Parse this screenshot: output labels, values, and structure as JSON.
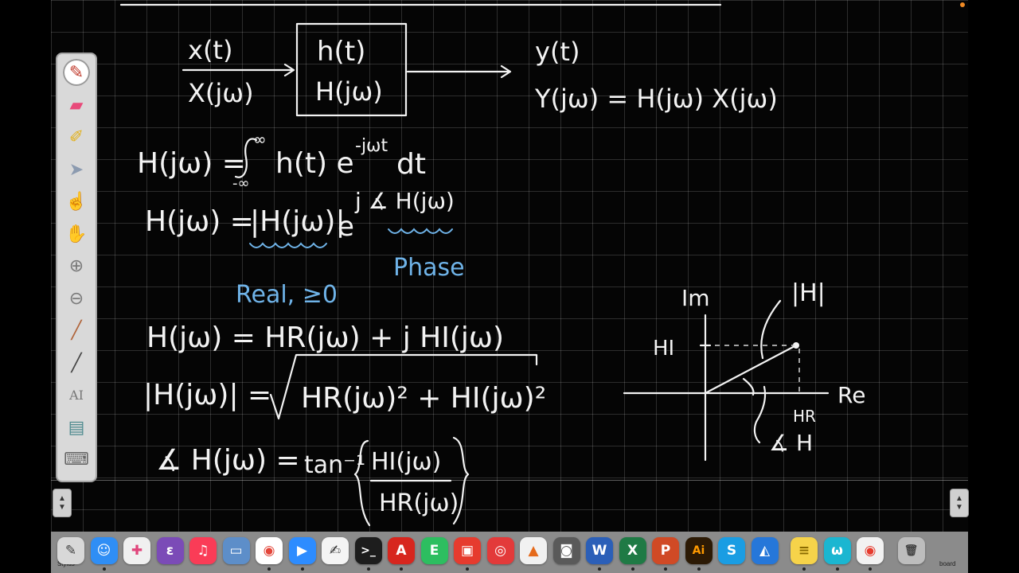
{
  "toolbar": {
    "tools": [
      {
        "name": "pen-icon",
        "glyph": "✎",
        "active": true
      },
      {
        "name": "eraser-icon",
        "glyph": "▰"
      },
      {
        "name": "highlighter-icon",
        "glyph": "✐"
      },
      {
        "name": "pointer-icon",
        "glyph": "➤"
      },
      {
        "name": "laser-pointer-icon",
        "glyph": "☝"
      },
      {
        "name": "hand-pan-icon",
        "glyph": "✋"
      },
      {
        "name": "zoom-in-icon",
        "glyph": "⊕"
      },
      {
        "name": "zoom-out-icon",
        "glyph": "⊖"
      },
      {
        "name": "brush-icon",
        "glyph": "╱"
      },
      {
        "name": "line-icon",
        "glyph": "╱"
      },
      {
        "name": "text-icon",
        "glyph": "AI"
      },
      {
        "name": "background-icon",
        "glyph": "▤"
      },
      {
        "name": "keyboard-icon",
        "glyph": "⌨"
      }
    ]
  },
  "equations": {
    "block_input_time": "x(t)",
    "block_input_freq": "X(jω)",
    "block_h_time": "h(t)",
    "block_h_freq": "H(jω)",
    "block_output_time": "y(t)",
    "block_output_freq": "Y(jω) = H(jω) X(jω)",
    "fourier_lhs": "H(jω) =",
    "fourier_upper_limit": "∞",
    "fourier_lower_limit": "-∞",
    "fourier_integrand": "h(t) e",
    "fourier_exponent": "-jωt",
    "fourier_dt": "dt",
    "polar_lhs": "H(jω) =",
    "polar_mag": "|H(jω)|",
    "polar_e": "e",
    "polar_exponent": "j ∡ H(jω)",
    "note_real": "Real, ≥0",
    "note_phase": "Phase",
    "rect_form": "H(jω) = HR(jω) + j HI(jω)",
    "mag_lhs": "|H(jω)| =",
    "mag_rhs": "HR(jω)² + HI(jω)²",
    "phase_lhs": "∡ H(jω) =",
    "phase_tan": "tan⁻¹",
    "phase_num": "HI(jω)",
    "phase_den": "HR(jω)"
  },
  "phasor_plot": {
    "im_label": "Im",
    "re_label": "Re",
    "mag_label": "|H|",
    "hi_label": "HI",
    "hr_label": "HR",
    "angle_label": "∡ H"
  },
  "dock": {
    "left_label": "Stylus",
    "right_label": "board",
    "apps": [
      {
        "name": "stylus-app-icon",
        "glyph": "✎",
        "bg": "#d8d8d8",
        "fg": "#444"
      },
      {
        "name": "finder-icon",
        "glyph": "☺",
        "bg": "#2f8ef5",
        "fg": "#fff"
      },
      {
        "name": "photos-app-icon",
        "glyph": "✚",
        "bg": "#f0f0f0",
        "fg": "#e0457b"
      },
      {
        "name": "emacs-icon",
        "glyph": "ε",
        "bg": "#7b4bb7",
        "fg": "#fff"
      },
      {
        "name": "music-icon",
        "glyph": "♫",
        "bg": "#fa3c57",
        "fg": "#fff"
      },
      {
        "name": "preview-icon",
        "glyph": "▭",
        "bg": "#5d8ec9",
        "fg": "#fff"
      },
      {
        "name": "chrome-icon",
        "glyph": "◉",
        "bg": "#ffffff",
        "fg": "#e3463a"
      },
      {
        "name": "zoom-icon",
        "glyph": "▶",
        "bg": "#2d8cff",
        "fg": "#fff"
      },
      {
        "name": "notes-pen-icon",
        "glyph": "✍",
        "bg": "#f4f4f4",
        "fg": "#333"
      },
      {
        "name": "terminal-icon",
        "glyph": ">_",
        "bg": "#1d1d1d",
        "fg": "#fff"
      },
      {
        "name": "acrobat-icon",
        "glyph": "A",
        "bg": "#d7261e",
        "fg": "#fff"
      },
      {
        "name": "evernote-icon",
        "glyph": "E",
        "bg": "#2dbe60",
        "fg": "#fff"
      },
      {
        "name": "screen-capture-icon",
        "glyph": "▣",
        "bg": "#e63b2e",
        "fg": "#fff"
      },
      {
        "name": "photo-booth-icon",
        "glyph": "◎",
        "bg": "#e33a3a",
        "fg": "#fff"
      },
      {
        "name": "matlab-icon",
        "glyph": "▲",
        "bg": "#f1f1f1",
        "fg": "#e56a1b"
      },
      {
        "name": "screenshot-icon",
        "glyph": "◙",
        "bg": "#5a5a5a",
        "fg": "#fff"
      },
      {
        "name": "word-icon",
        "glyph": "W",
        "bg": "#2b5fb8",
        "fg": "#fff"
      },
      {
        "name": "excel-icon",
        "glyph": "X",
        "bg": "#1f7a45",
        "fg": "#fff"
      },
      {
        "name": "powerpoint-icon",
        "glyph": "P",
        "bg": "#d04a25",
        "fg": "#fff"
      },
      {
        "name": "illustrator-icon",
        "glyph": "Ai",
        "bg": "#2c1a05",
        "fg": "#ff9a00"
      },
      {
        "name": "skype-icon",
        "glyph": "S",
        "bg": "#1a9de3",
        "fg": "#fff"
      },
      {
        "name": "safari-icon",
        "glyph": "◭",
        "bg": "#2677d9",
        "fg": "#fff"
      },
      {
        "name": "stickies-icon",
        "glyph": "≡",
        "bg": "#f6d34a",
        "fg": "#8a6a00"
      },
      {
        "name": "webex-icon",
        "glyph": "ω",
        "bg": "#1bb6d1",
        "fg": "#fff"
      },
      {
        "name": "record-app-icon",
        "glyph": "◉",
        "bg": "#f2f2f2",
        "fg": "#e63b2e"
      },
      {
        "name": "trash-icon",
        "glyph": "🗑",
        "bg": "#bdbdbd",
        "fg": "#444"
      }
    ]
  }
}
